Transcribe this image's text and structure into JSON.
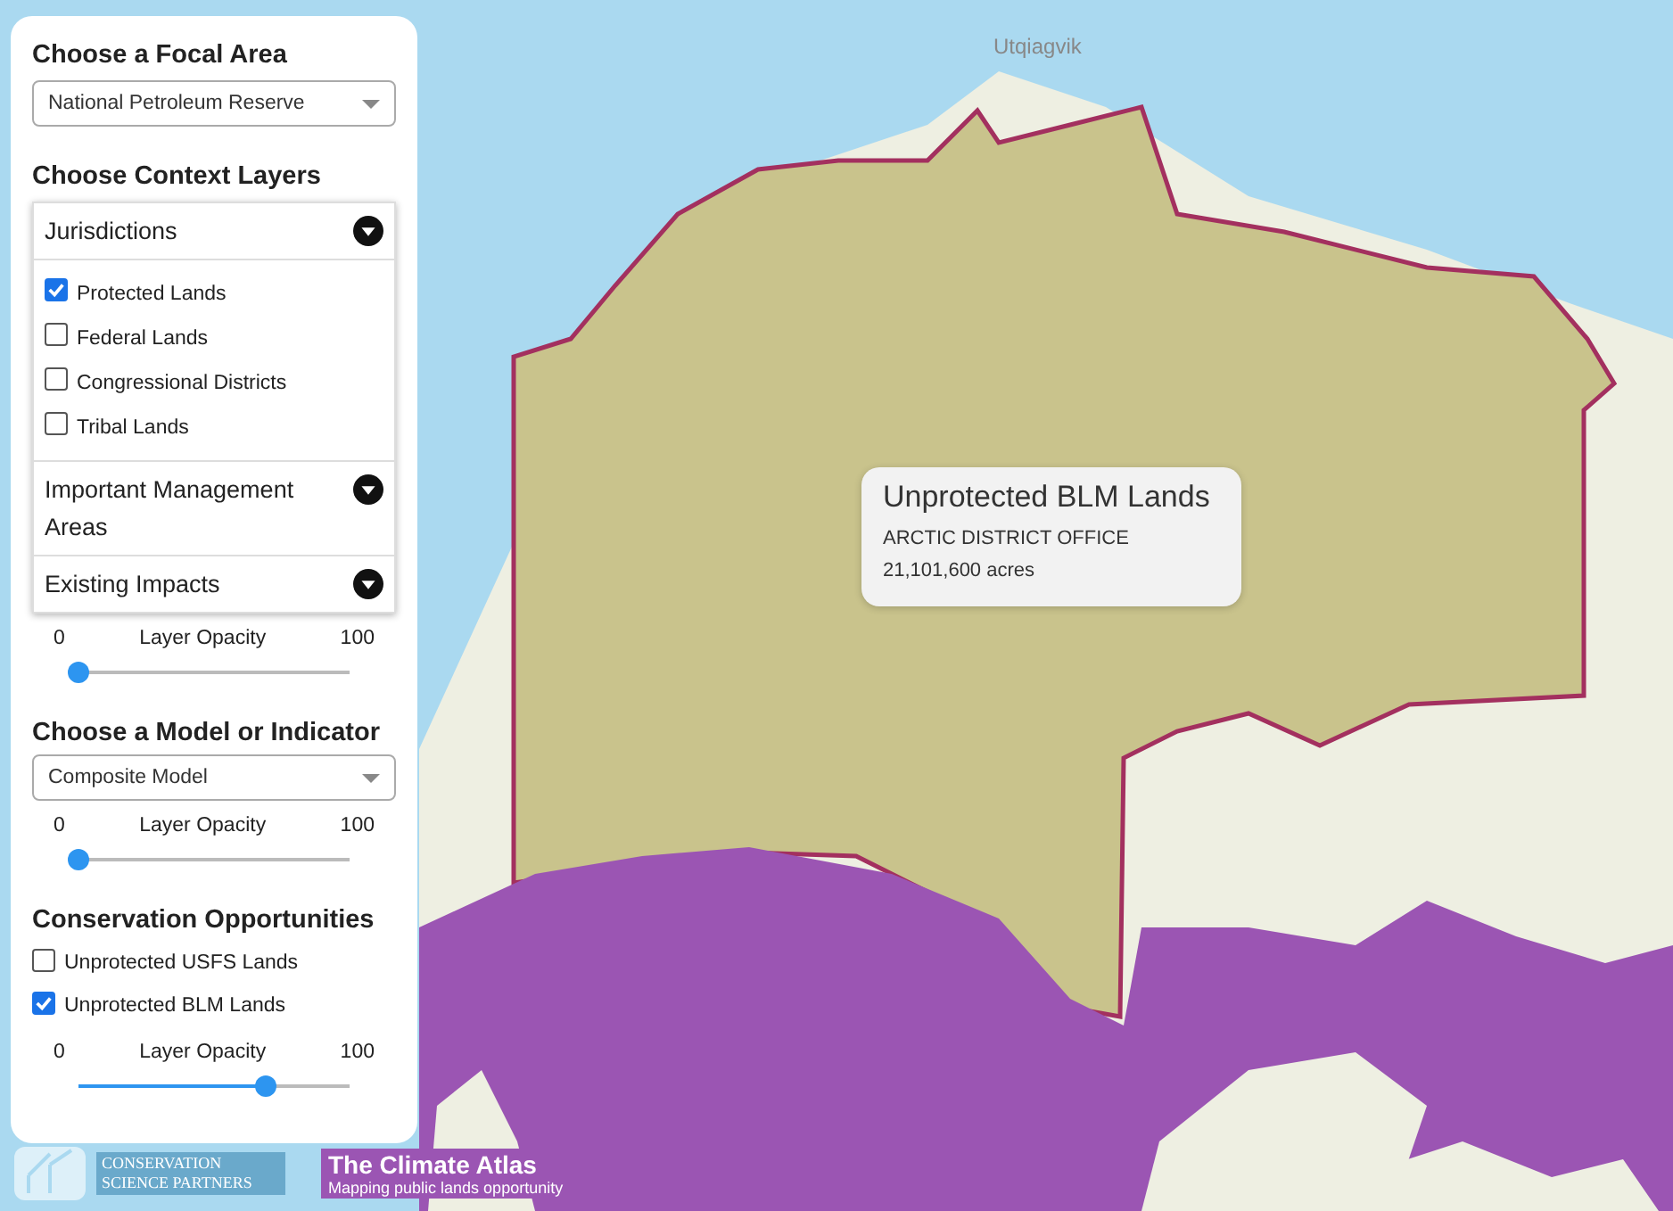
{
  "focal_area": {
    "heading": "Choose a Focal Area",
    "select": "National Petroleum Reserve"
  },
  "context_layers": {
    "heading": "Choose Context Layers",
    "sections": [
      {
        "title": "Jurisdictions",
        "items": [
          {
            "label": "Protected Lands",
            "checked": true
          },
          {
            "label": "Federal Lands",
            "checked": false
          },
          {
            "label": "Congressional Districts",
            "checked": false
          },
          {
            "label": "Tribal Lands",
            "checked": false
          }
        ]
      },
      {
        "title": "Important Management Areas"
      },
      {
        "title": "Existing Impacts"
      }
    ],
    "opacity": {
      "min": "0",
      "label": "Layer Opacity",
      "max": "100",
      "level": 0
    }
  },
  "model": {
    "heading": "Choose a Model or Indicator",
    "select": "Composite Model",
    "opacity": {
      "min": "0",
      "label": "Layer Opacity",
      "max": "100",
      "level": 0
    }
  },
  "opportunities": {
    "heading": "Conservation Opportunities",
    "items": [
      {
        "label": "Unprotected USFS Lands",
        "checked": false
      },
      {
        "label": "Unprotected BLM Lands",
        "checked": true
      }
    ],
    "opacity": {
      "min": "0",
      "label": "Layer Opacity",
      "max": "100",
      "level": 0.64
    }
  },
  "map": {
    "place_label": "Utqiagvik",
    "tooltip": {
      "title": "Unprotected BLM Lands",
      "subtitle": "ARCTIC DISTRICT OFFICE",
      "acres": "21,101,600 acres"
    }
  },
  "branding": {
    "partner": "CONSERVATION SCIENCE PARTNERS",
    "atlas_title": "The Climate Atlas",
    "atlas_subtitle": "Mapping public lands opportunity"
  }
}
